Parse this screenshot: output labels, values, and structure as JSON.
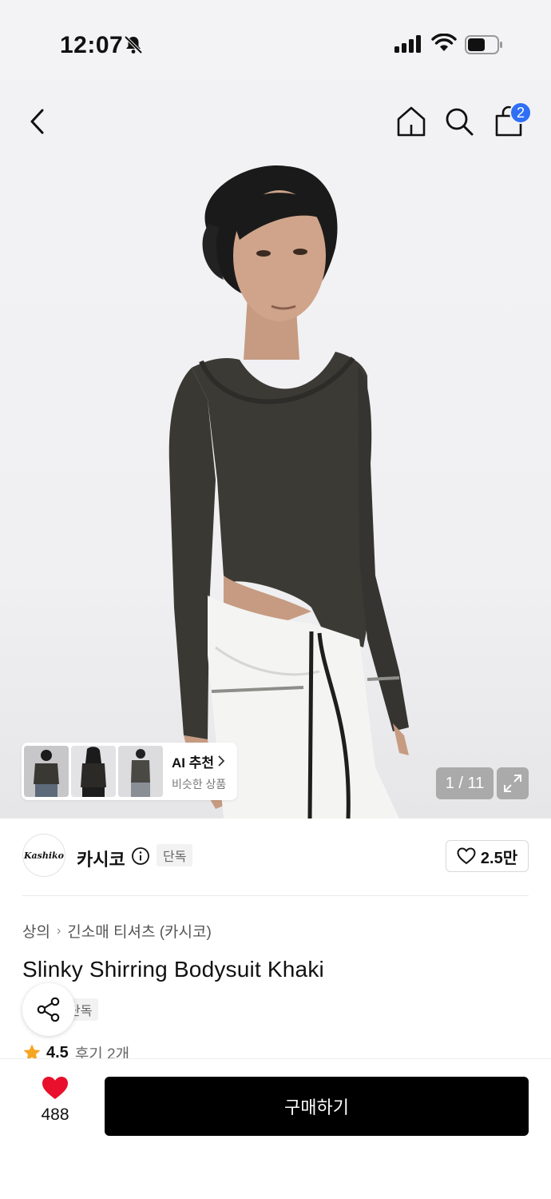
{
  "status_bar": {
    "time": "12:07",
    "icons": [
      "bell-off-icon",
      "signal-icon",
      "wifi-icon",
      "battery-icon"
    ]
  },
  "nav": {
    "icons": [
      "back-icon",
      "home-icon",
      "search-icon",
      "cart-icon"
    ],
    "cart_count": "2"
  },
  "gallery": {
    "pager": "1 / 11",
    "ai_recommend": {
      "title": "AI 추천",
      "subtitle": "비슷한 상품"
    }
  },
  "brand": {
    "logo_text": "Kashiko",
    "name": "카시코",
    "tag": "단독",
    "likes": "2.5만"
  },
  "breadcrumb": {
    "level1": "상의",
    "level2": "긴소매 티셔츠 (카시코)"
  },
  "product": {
    "title": "Slinky Shirring Bodysuit Khaki",
    "tag": "단독",
    "rating": "4.5",
    "reviews": "후기 2개"
  },
  "bottom_bar": {
    "like_count": "488",
    "buy_label": "구매하기"
  },
  "colors": {
    "accent_blue": "#2f6ff5",
    "heart_red": "#e8102c",
    "star": "#f5a623",
    "buy_button": "#000000"
  }
}
